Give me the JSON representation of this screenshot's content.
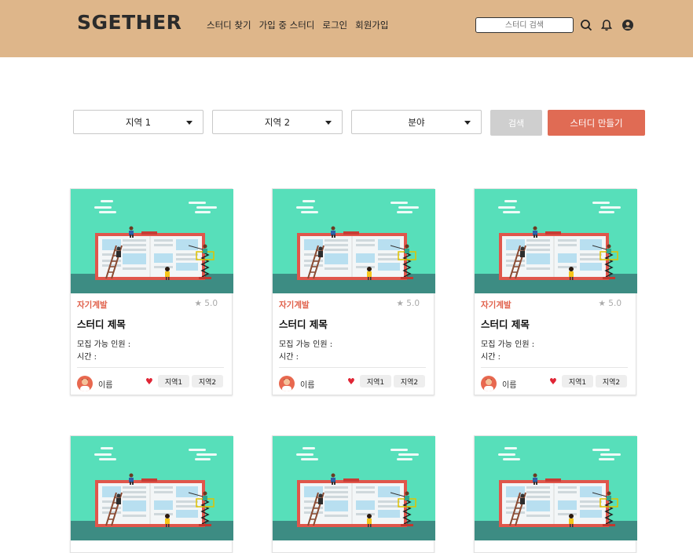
{
  "header": {
    "logo": "SGETHER",
    "nav": [
      "스터디 찾기",
      "가입 중 스터디",
      "로그인",
      "회원가입"
    ],
    "search_placeholder": "스터디 검색",
    "icons": [
      "search-icon",
      "bell-icon",
      "user-icon"
    ]
  },
  "filters": {
    "region1": "지역 1",
    "region2": "지역 2",
    "field": "분야",
    "search_button": "검색",
    "create_button": "스터디 만들기"
  },
  "cards": [
    {
      "category": "자기계발",
      "rating": "5.0",
      "title": "스터디 제목",
      "capacity_label": "모집 가능 인원 :",
      "time_label": "시간 :",
      "author": "이름",
      "tags": [
        "지역1",
        "지역2"
      ]
    },
    {
      "category": "자기계발",
      "rating": "5.0",
      "title": "스터디 제목",
      "capacity_label": "모집 가능 인원 :",
      "time_label": "시간 :",
      "author": "이름",
      "tags": [
        "지역1",
        "지역2"
      ]
    },
    {
      "category": "자기계발",
      "rating": "5.0",
      "title": "스터디 제목",
      "capacity_label": "모집 가능 인원 :",
      "time_label": "시간 :",
      "author": "이름",
      "tags": [
        "지역1",
        "지역2"
      ]
    }
  ],
  "colors": {
    "header_bg": "#deb68a",
    "accent": "#e06b54",
    "thumb_bg": "#57dfba",
    "category": "#e0604a",
    "heart": "#e02535"
  }
}
